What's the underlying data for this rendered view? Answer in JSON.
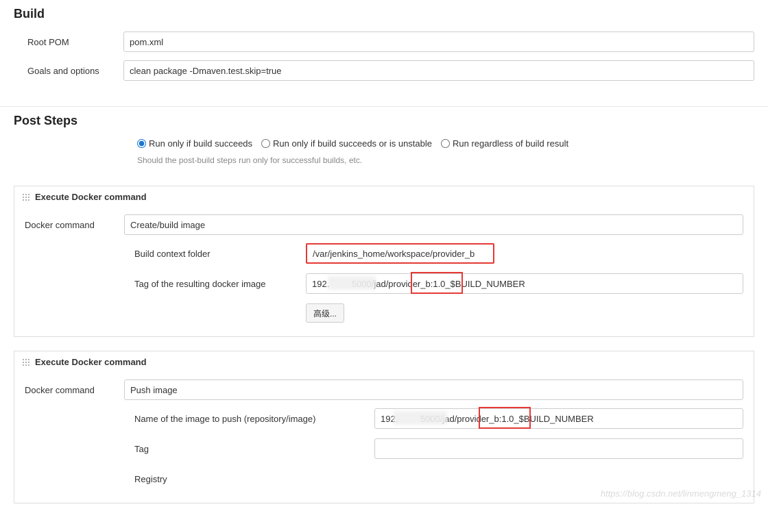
{
  "build": {
    "title": "Build",
    "root_pom_label": "Root POM",
    "root_pom_value": "pom.xml",
    "goals_label": "Goals and options",
    "goals_value": "clean package -Dmaven.test.skip=true"
  },
  "post_steps": {
    "title": "Post Steps",
    "radio_options": [
      {
        "label": "Run only if build succeeds",
        "checked": true
      },
      {
        "label": "Run only if build succeeds or is unstable",
        "checked": false
      },
      {
        "label": "Run regardless of build result",
        "checked": false
      }
    ],
    "help_text": "Should the post-build steps run only for successful builds, etc."
  },
  "docker_build": {
    "header": "Execute Docker command",
    "command_label": "Docker command",
    "command_value": "Create/build image",
    "context_label": "Build context folder",
    "context_value": "/var/jenkins_home/workspace/provider_b",
    "tag_label": "Tag of the resulting docker image",
    "tag_value": "192.         5000/jad/provider_b:1.0_$BUILD_NUMBER",
    "advanced_label": "高级..."
  },
  "docker_push": {
    "header": "Execute Docker command",
    "command_label": "Docker command",
    "command_value": "Push image",
    "image_name_label": "Name of the image to push (repository/image)",
    "image_name_value": "192.         5000/jad/provider_b:1.0_$BUILD_NUMBER",
    "tag_label": "Tag",
    "tag_value": "",
    "registry_label": "Registry",
    "registry_value": ""
  },
  "watermark": "https://blog.csdn.net/linmengmeng_1314"
}
